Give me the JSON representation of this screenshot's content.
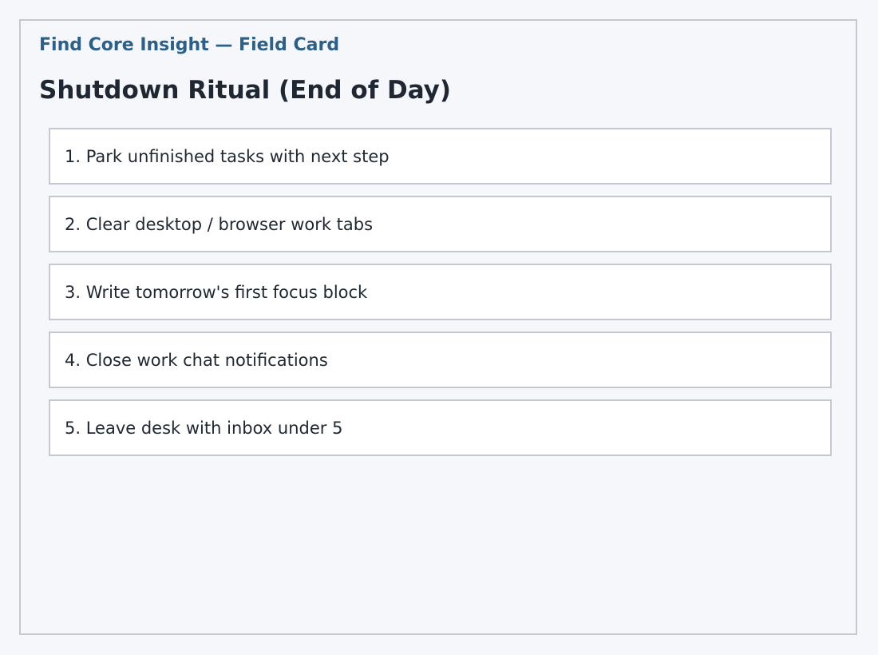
{
  "card": {
    "kicker": "Find Core Insight — Field Card",
    "title": "Shutdown Ritual (End of Day)",
    "steps": [
      {
        "label": "1. Park unfinished tasks with next step"
      },
      {
        "label": "2. Clear desktop / browser work tabs"
      },
      {
        "label": "3. Write tomorrow's first focus block"
      },
      {
        "label": "4. Close work chat notifications"
      },
      {
        "label": "5. Leave desk with inbox under 5"
      }
    ]
  },
  "colors": {
    "background": "#f5f7fa",
    "border": "#c3c8d1",
    "kicker": "#2a6089",
    "text": "#1f2733",
    "step_background": "#ffffff"
  }
}
